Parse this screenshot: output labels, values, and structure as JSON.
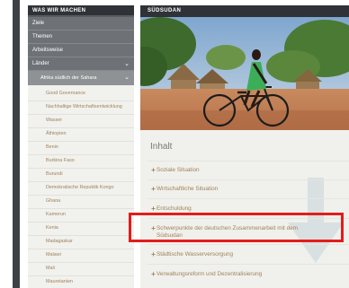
{
  "sidebar": {
    "header": "WAS WIR MACHEN",
    "nav": [
      {
        "label": "Ziele"
      },
      {
        "label": "Themen"
      },
      {
        "label": "Arbeitsweise"
      },
      {
        "label": "Länder",
        "expanded": true
      }
    ],
    "subsection": {
      "label": "Afrika südlich der Sahara",
      "expanded": true
    },
    "countries": [
      "Good Governance",
      "Nachhaltige Wirtschaftsentwicklung",
      "Wasser",
      "Äthiopien",
      "Benin",
      "Burkina Faso",
      "Burundi",
      "Demokratische Republik Kongo",
      "Ghana",
      "Kamerun",
      "Kenia",
      "Madagaskar",
      "Malawi",
      "Mali",
      "Mauretanien"
    ]
  },
  "main": {
    "header": "SÜDSUDAN",
    "hero_alt_icon": "bicycle-photo",
    "inhalt_title": "Inhalt",
    "toc": [
      {
        "label": "Soziale Situation"
      },
      {
        "label": "Wirtschaftliche Situation"
      },
      {
        "label": "Entschuldung"
      },
      {
        "label": "Schwerpunkte der deutschen Zusammenarbeit mit dem Südsudan",
        "highlighted": true
      },
      {
        "label": "Städtische Wasserversorgung"
      },
      {
        "label": "Verwaltungsreform und Dezentralisierung"
      }
    ]
  },
  "colors": {
    "header_bg": "#2f3338",
    "nav_bg": "#6e7276",
    "link": "#a0825a",
    "highlight": "#e31c1c"
  }
}
